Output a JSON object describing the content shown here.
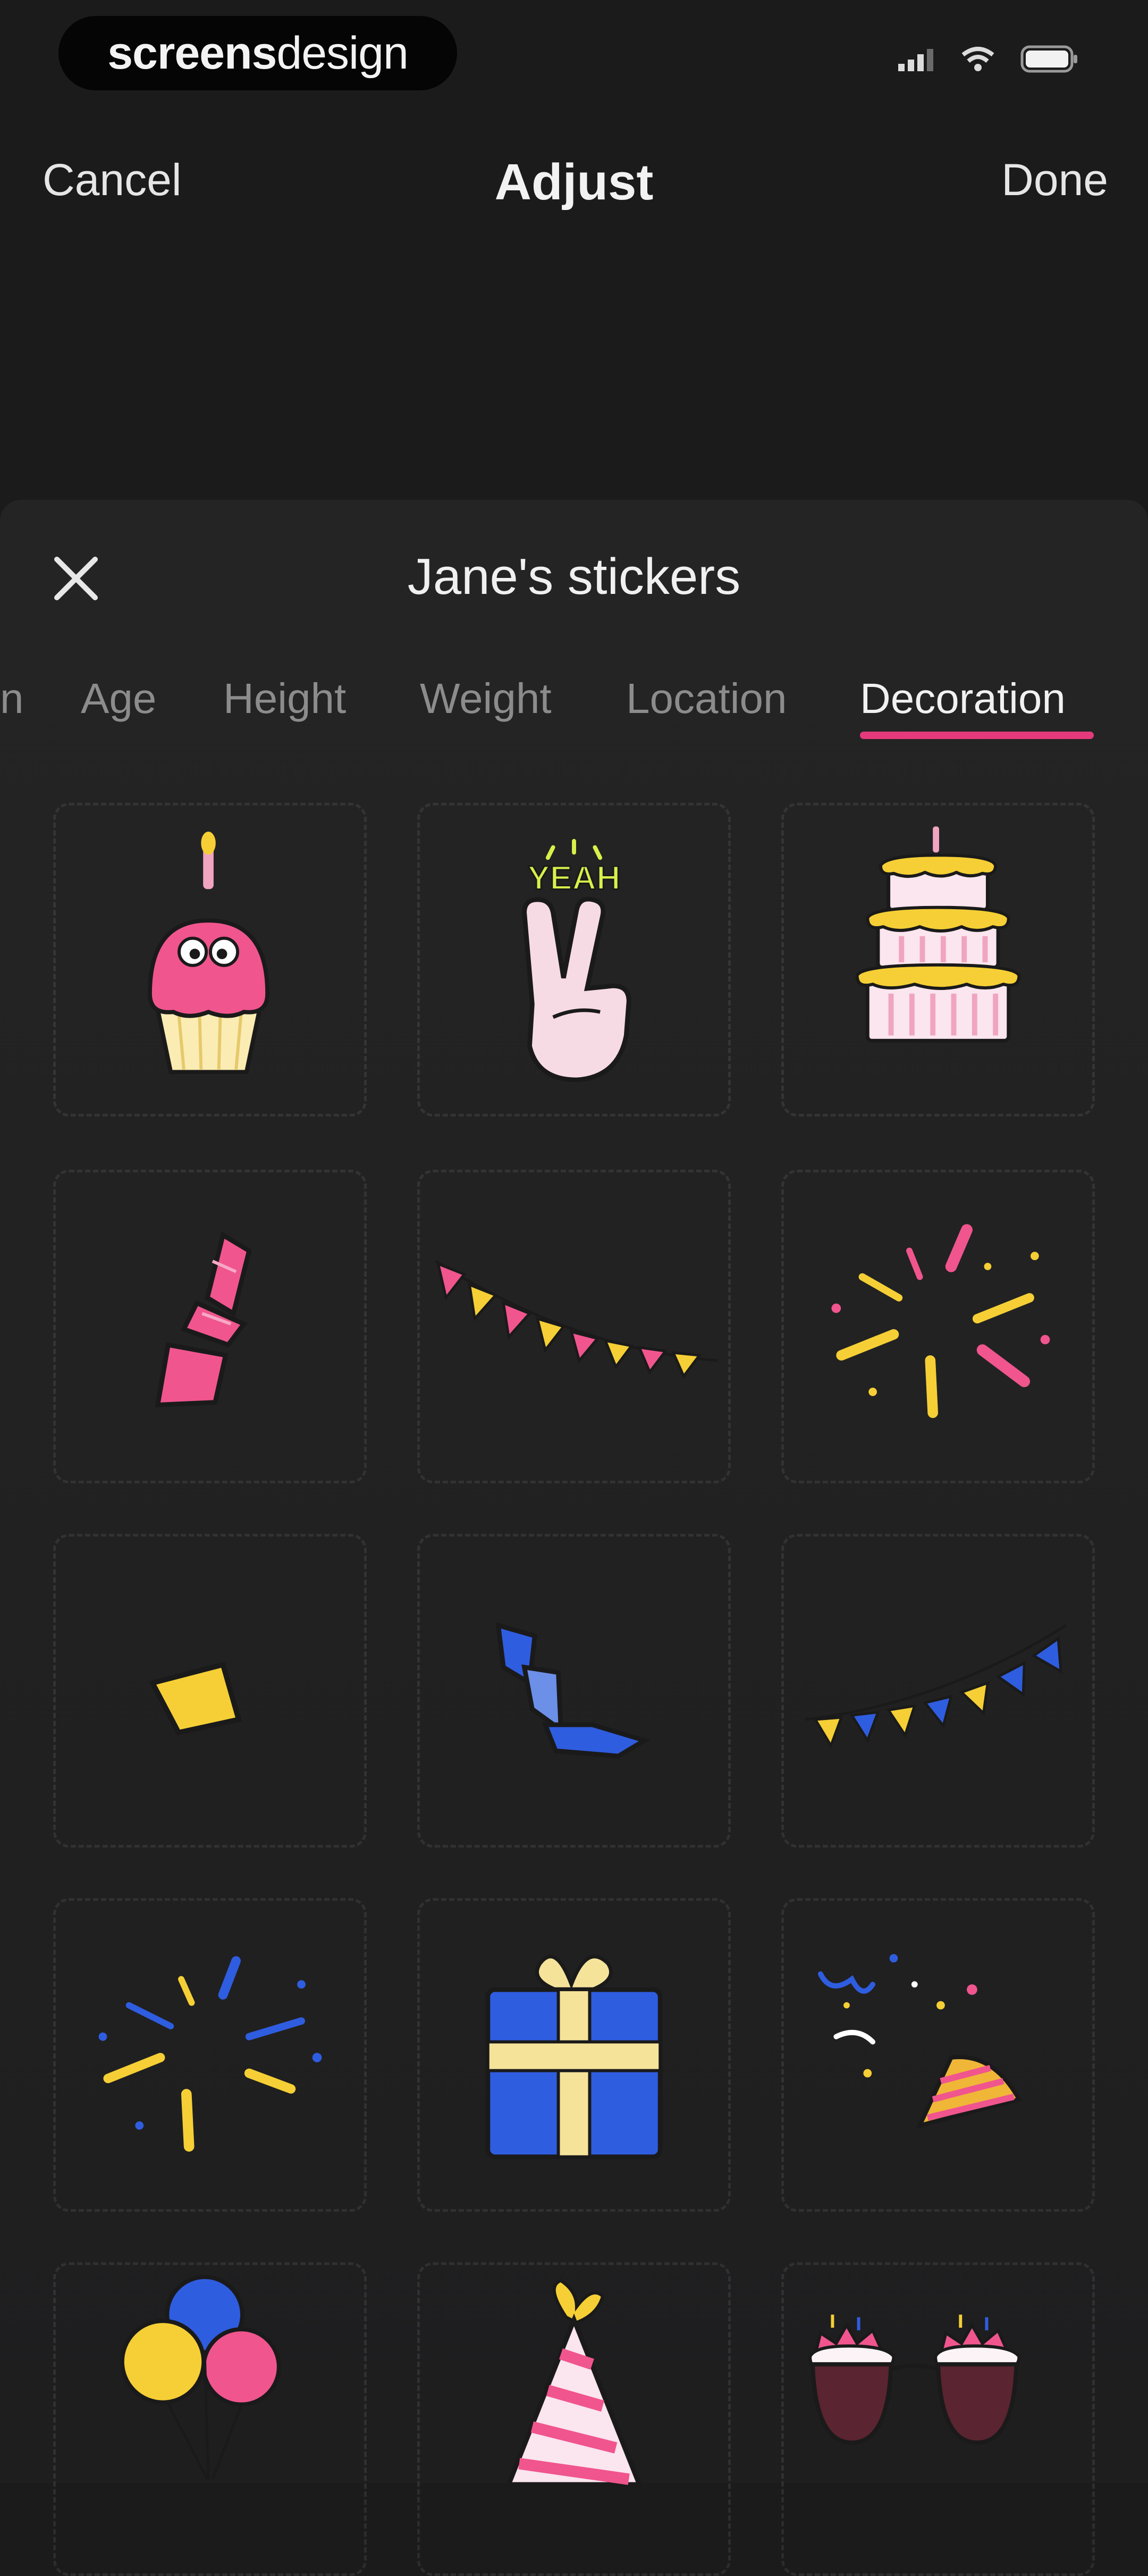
{
  "status_bar": {
    "watermark_bold": "screens",
    "watermark_light": "design",
    "icons": [
      "signal-icon",
      "wifi-icon",
      "battery-icon"
    ]
  },
  "nav": {
    "cancel_label": "Cancel",
    "title": "Adjust",
    "done_label": "Done"
  },
  "sheet": {
    "title": "Jane's stickers",
    "close_icon": "close-icon"
  },
  "tabs": [
    {
      "label": "n",
      "active": false
    },
    {
      "label": "Age",
      "active": false
    },
    {
      "label": "Height",
      "active": false
    },
    {
      "label": "Weight",
      "active": false
    },
    {
      "label": "Location",
      "active": false
    },
    {
      "label": "Decoration",
      "active": true
    }
  ],
  "colors": {
    "accent": "#e43a7b",
    "sticker_pink": "#f0558e",
    "sticker_yellow": "#f5cf35",
    "sticker_blue": "#2f5de0"
  },
  "stickers": [
    {
      "name": "cupcake-sticker",
      "text": ""
    },
    {
      "name": "peace-hand-sticker",
      "text": "YEAH"
    },
    {
      "name": "layered-cake-sticker",
      "text": ""
    },
    {
      "name": "pink-streamer-sticker",
      "text": ""
    },
    {
      "name": "pink-bunting-sticker",
      "text": ""
    },
    {
      "name": "pink-fireworks-sticker",
      "text": ""
    },
    {
      "name": "yellow-confetti-sticker",
      "text": ""
    },
    {
      "name": "blue-streamer-sticker",
      "text": ""
    },
    {
      "name": "blue-bunting-sticker",
      "text": ""
    },
    {
      "name": "blue-fireworks-sticker",
      "text": ""
    },
    {
      "name": "gift-box-sticker",
      "text": ""
    },
    {
      "name": "party-popper-sticker",
      "text": ""
    },
    {
      "name": "balloons-sticker",
      "text": ""
    },
    {
      "name": "party-hat-sticker",
      "text": ""
    },
    {
      "name": "birthday-glasses-sticker",
      "text": ""
    }
  ]
}
